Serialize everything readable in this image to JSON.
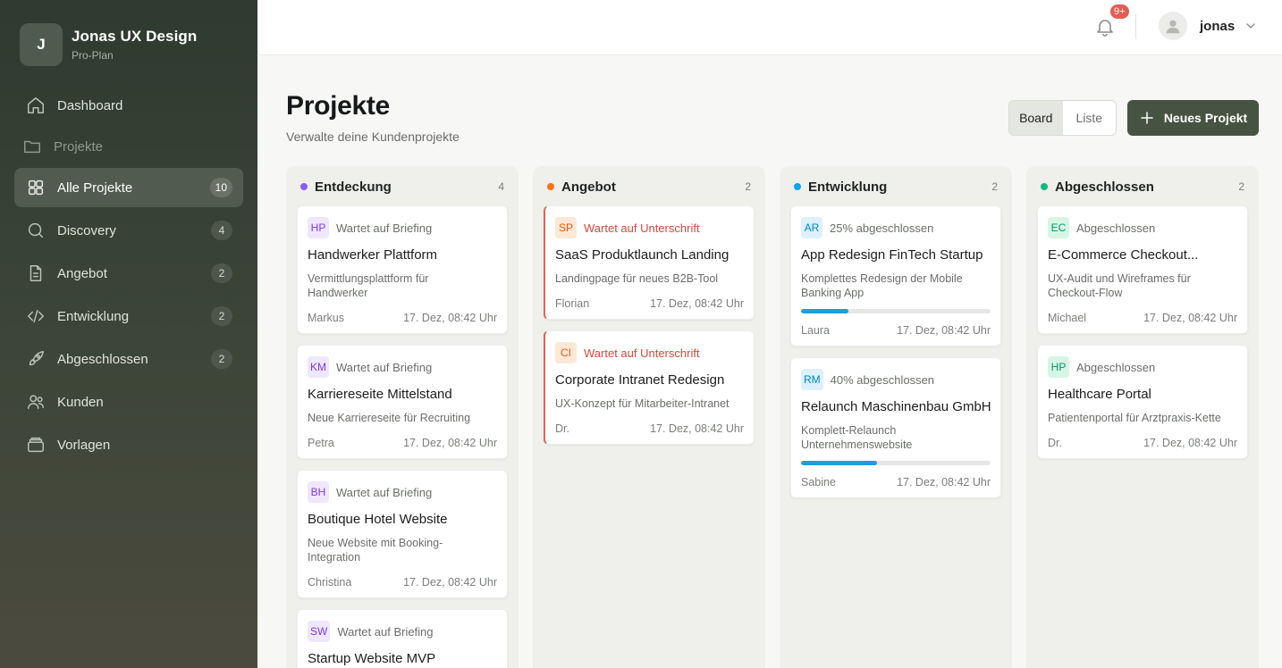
{
  "brand": {
    "initial": "J",
    "name": "Jonas UX Design",
    "plan": "Pro-Plan"
  },
  "sidebar": {
    "items": [
      {
        "label": "Dashboard",
        "icon": "home-icon"
      },
      {
        "label": "Projekte",
        "icon": "folder-icon",
        "section": true
      },
      {
        "label": "Alle Projekte",
        "icon": "grid-icon",
        "badge": "10",
        "active": true
      },
      {
        "label": "Discovery",
        "icon": "search-icon",
        "badge": "4"
      },
      {
        "label": "Angebot",
        "icon": "document-icon",
        "badge": "2"
      },
      {
        "label": "Entwicklung",
        "icon": "code-icon",
        "badge": "2"
      },
      {
        "label": "Abgeschlossen",
        "icon": "rocket-icon",
        "badge": "2"
      },
      {
        "label": "Kunden",
        "icon": "users-icon"
      },
      {
        "label": "Vorlagen",
        "icon": "archive-icon"
      }
    ]
  },
  "topbar": {
    "notifications": "9+",
    "user_name": "jonas"
  },
  "header": {
    "title": "Projekte",
    "subtitle": "Verwalte deine Kundenprojekte",
    "view_board": "Board",
    "view_list": "Liste",
    "new_project": "Neues Projekt"
  },
  "colors": {
    "accent": "#465242",
    "purple": "#8b5cf6",
    "orange": "#f97316",
    "blue": "#0ea5e9",
    "green": "#10b981",
    "warn": "#d14a3a"
  },
  "columns": [
    {
      "title": "Entdeckung",
      "count": "4",
      "dot": "#8b5cf6",
      "cards": [
        {
          "initials": "HP",
          "status": "Wartet auf Briefing",
          "title": "Handwerker Plattform",
          "desc": "Vermittlungsplattform für Handwerker",
          "owner": "Markus",
          "date": "17. Dez, 08:42 Uhr"
        },
        {
          "initials": "KM",
          "status": "Wartet auf Briefing",
          "title": "Karriereseite Mittelstand",
          "desc": "Neue Karriereseite für Recruiting",
          "owner": "Petra",
          "date": "17. Dez, 08:42 Uhr"
        },
        {
          "initials": "BH",
          "status": "Wartet auf Briefing",
          "title": "Boutique Hotel Website",
          "desc": "Neue Website mit Booking-Integration",
          "owner": "Christina",
          "date": "17. Dez, 08:42 Uhr"
        },
        {
          "initials": "SW",
          "status": "Wartet auf Briefing",
          "title": "Startup Website MVP",
          "desc": "",
          "owner": "",
          "date": ""
        }
      ]
    },
    {
      "title": "Angebot",
      "count": "2",
      "dot": "#f97316",
      "cards": [
        {
          "initials": "SP",
          "status": "Wartet auf Unterschrift",
          "title": "SaaS Produktlaunch Landing",
          "desc": "Landingpage für neues B2B-Tool",
          "owner": "Florian",
          "date": "17. Dez, 08:42 Uhr"
        },
        {
          "initials": "CI",
          "status": "Wartet auf Unterschrift",
          "title": "Corporate Intranet Redesign",
          "desc": "UX-Konzept für Mitarbeiter-Intranet",
          "owner": "Dr.",
          "date": "17. Dez, 08:42 Uhr"
        }
      ]
    },
    {
      "title": "Entwicklung",
      "count": "2",
      "dot": "#0ea5e9",
      "cards": [
        {
          "initials": "AR",
          "status": "25% abgeschlossen",
          "progress": 0.25,
          "title": "App Redesign FinTech Startup",
          "desc": "Komplettes Redesign der Mobile Banking App",
          "owner": "Laura",
          "date": "17. Dez, 08:42 Uhr"
        },
        {
          "initials": "RM",
          "status": "40% abgeschlossen",
          "progress": 0.4,
          "title": "Relaunch Maschinenbau GmbH",
          "desc": "Komplett-Relaunch Unternehmenswebsite",
          "owner": "Sabine",
          "date": "17. Dez, 08:42 Uhr"
        }
      ]
    },
    {
      "title": "Abgeschlossen",
      "count": "2",
      "dot": "#10b981",
      "cards": [
        {
          "initials": "EC",
          "status": "Abgeschlossen",
          "title": "E-Commerce Checkout...",
          "desc": "UX-Audit und Wireframes für Checkout-Flow",
          "owner": "Michael",
          "date": "17. Dez, 08:42 Uhr"
        },
        {
          "initials": "HP",
          "status": "Abgeschlossen",
          "title": "Healthcare Portal",
          "desc": "Patientenportal für Arztpraxis-Kette",
          "owner": "Dr.",
          "date": "17. Dez, 08:42 Uhr"
        }
      ]
    }
  ]
}
